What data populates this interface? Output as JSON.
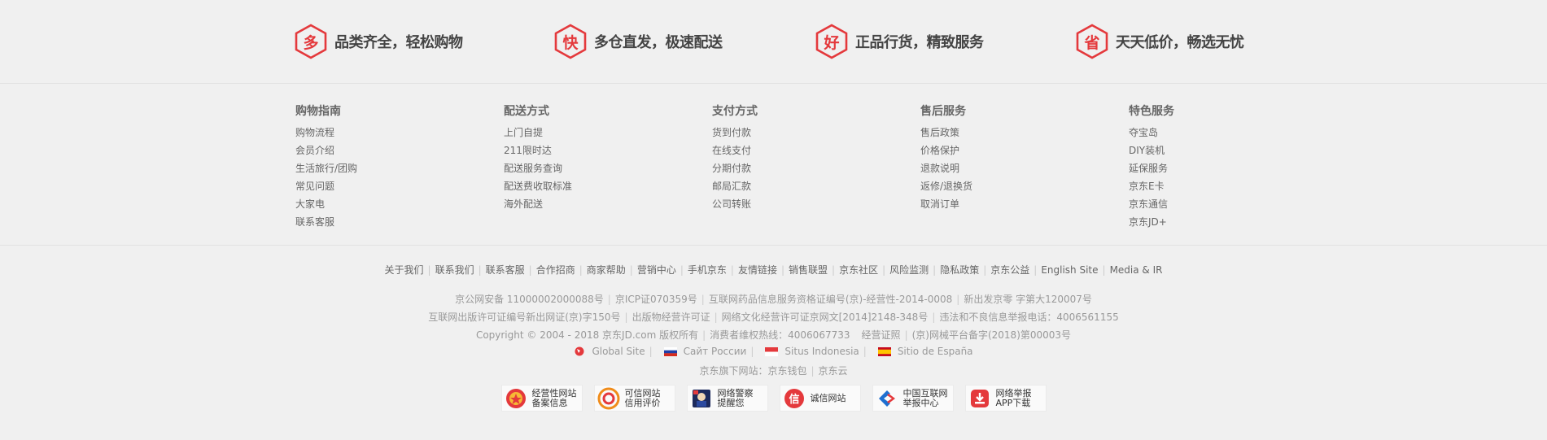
{
  "promise": [
    {
      "char": "多",
      "text": "品类齐全，轻松购物"
    },
    {
      "char": "快",
      "text": "多仓直发，极速配送"
    },
    {
      "char": "好",
      "text": "正品行货，精致服务"
    },
    {
      "char": "省",
      "text": "天天低价，畅选无忧"
    }
  ],
  "help": [
    {
      "title": "购物指南",
      "items": [
        "购物流程",
        "会员介绍",
        "生活旅行/团购",
        "常见问题",
        "大家电",
        "联系客服"
      ]
    },
    {
      "title": "配送方式",
      "items": [
        "上门自提",
        "211限时达",
        "配送服务查询",
        "配送费收取标准",
        "海外配送"
      ]
    },
    {
      "title": "支付方式",
      "items": [
        "货到付款",
        "在线支付",
        "分期付款",
        "邮局汇款",
        "公司转账"
      ]
    },
    {
      "title": "售后服务",
      "items": [
        "售后政策",
        "价格保护",
        "退款说明",
        "返修/退换货",
        "取消订单"
      ]
    },
    {
      "title": "特色服务",
      "items": [
        "夺宝岛",
        "DIY装机",
        "延保服务",
        "京东E卡",
        "京东通信",
        "京东JD+"
      ]
    }
  ],
  "footer_links": [
    "关于我们",
    "联系我们",
    "联系客服",
    "合作招商",
    "商家帮助",
    "营销中心",
    "手机京东",
    "友情链接",
    "销售联盟",
    "京东社区",
    "风险监测",
    "隐私政策",
    "京东公益",
    "English Site",
    "Media & IR"
  ],
  "license_row1": [
    "京公网安备 11000002000088号",
    "京ICP证070359号",
    "互联网药品信息服务资格证编号(京)-经营性-2014-0008",
    "新出发京零 字第大120007号"
  ],
  "license_row2": [
    "互联网出版许可证编号新出网证(京)字150号",
    "出版物经营许可证",
    "网络文化经营许可证京网文[2014]2148-348号",
    "违法和不良信息举报电话：4006561155"
  ],
  "license_row3": [
    "Copyright © 2004 - 2018  京东JD.com 版权所有",
    "消费者维权热线：4006067733",
    "经营证照",
    "(京)网械平台备字(2018)第00003号"
  ],
  "sites": [
    "Global Site",
    "Сайт России",
    "Situs Indonesia",
    "Sitio de España"
  ],
  "brand_sites": {
    "label": "京东旗下网站：",
    "items": [
      "京东钱包",
      "京东云"
    ]
  },
  "certs": [
    {
      "icon": "police-badge-icon",
      "text": "经营性网站\n备案信息"
    },
    {
      "icon": "trust-credit-icon",
      "text": "可信网站\n信用评价"
    },
    {
      "icon": "police-alert-icon",
      "text": "网络警察\n提醒您"
    },
    {
      "icon": "integrity-site-icon",
      "text": "诚信网站"
    },
    {
      "icon": "internet-report-icon",
      "text": "中国互联网\n举报中心"
    },
    {
      "icon": "report-app-download-icon",
      "text": "网络举报\nAPP下载"
    }
  ],
  "colors": {
    "accent": "#e4393c",
    "background": "#f0f0f0"
  }
}
